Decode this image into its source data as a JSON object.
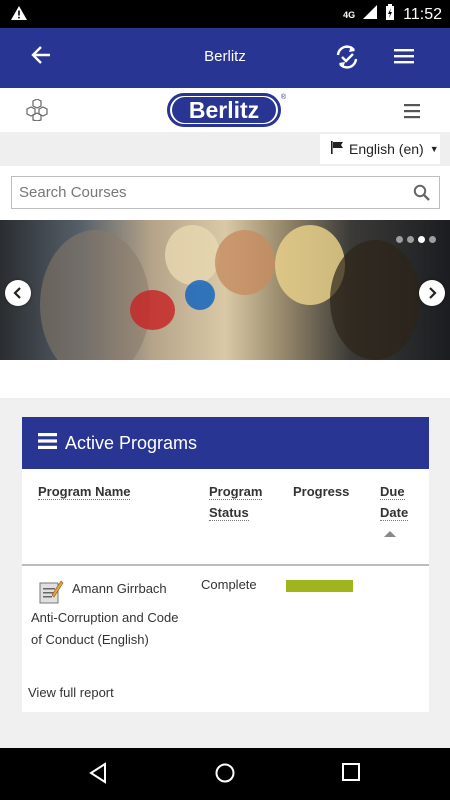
{
  "status_bar": {
    "network": "4G",
    "time": "11:52"
  },
  "app_bar": {
    "title": "Berlitz",
    "icons": [
      "back-arrow-icon",
      "sync-icon",
      "hamburger-menu-icon"
    ]
  },
  "site_header": {
    "logo_text": "Berlitz",
    "logo_mark": "®"
  },
  "language": {
    "selected": "English (en)"
  },
  "search": {
    "placeholder": "Search Courses"
  },
  "carousel": {
    "slide_count": 4,
    "active_slide": 3
  },
  "active_programs": {
    "title": "Active Programs",
    "columns": {
      "program_name": "Program Name",
      "program_status_1": "Program",
      "program_status_2": "Status",
      "progress": "Progress",
      "due_date_1": "Due",
      "due_date_2": "Date"
    },
    "rows": [
      {
        "name_line1": "Amann Girrbach",
        "name_line2": "Anti-Corruption and Code",
        "name_line3": "of Conduct (English)",
        "status": "Complete",
        "progress": 1.0,
        "due_date": ""
      }
    ],
    "view_full_report": "View full report"
  },
  "colors": {
    "primary": "#283593",
    "progress_fill": "#a0b41e"
  }
}
